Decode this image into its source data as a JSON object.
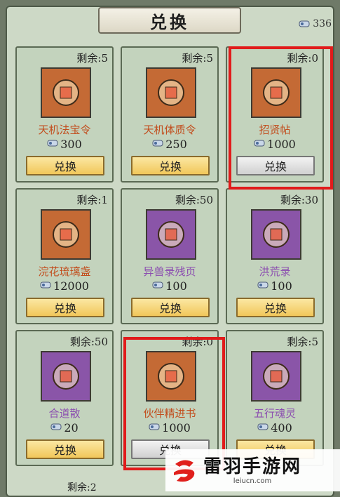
{
  "header": {
    "title": "兑换",
    "currency_icon": "scroll-currency-icon",
    "currency_amount": "336"
  },
  "items": [
    {
      "remain": "剩余:5",
      "name": "天机法宝令",
      "name_color": "orange",
      "price": "300",
      "button": "兑换",
      "icon": "medal-token-icon",
      "bg": "orange"
    },
    {
      "remain": "剩余:5",
      "name": "天机体质令",
      "name_color": "orange",
      "price": "250",
      "button": "兑换",
      "icon": "medal-token-icon",
      "bg": "orange"
    },
    {
      "remain": "剩余:0",
      "name": "招贤帖",
      "name_color": "orange",
      "price": "1000",
      "button": "兑换",
      "icon": "red-letter-icon",
      "bg": "orange",
      "disabled": true,
      "highlighted": true
    },
    {
      "remain": "剩余:1",
      "name": "浣花琉璃盏",
      "name_color": "orange",
      "price": "12000",
      "button": "兑换",
      "icon": "lantern-icon",
      "bg": "orange"
    },
    {
      "remain": "剩余:50",
      "name": "异兽录残页",
      "name_color": "purple",
      "price": "100",
      "button": "兑换",
      "icon": "torn-pages-icon",
      "bg": "purple"
    },
    {
      "remain": "剩余:30",
      "name": "洪荒录",
      "name_color": "purple",
      "price": "100",
      "button": "兑换",
      "icon": "scroll-bundle-icon",
      "bg": "purple"
    },
    {
      "remain": "剩余:50",
      "name": "合道散",
      "name_color": "purple",
      "price": "20",
      "button": "兑换",
      "icon": "potion-bottle-icon",
      "bg": "purple"
    },
    {
      "remain": "剩余:0",
      "name": "伙伴精进书",
      "name_color": "orange",
      "price": "1000",
      "button": "兑换",
      "icon": "book-icon",
      "bg": "orange",
      "disabled": true,
      "highlighted": true
    },
    {
      "remain": "剩余:5",
      "name": "五行魂灵",
      "name_color": "purple",
      "price": "400",
      "button": "兑换",
      "icon": "spirit-pouch-icon",
      "bg": "purple"
    }
  ],
  "next_row_partial": [
    "剩余:2"
  ],
  "watermark": {
    "name": "雷羽手游网",
    "url": "leiucn.com",
    "accent": "#e0201c"
  }
}
